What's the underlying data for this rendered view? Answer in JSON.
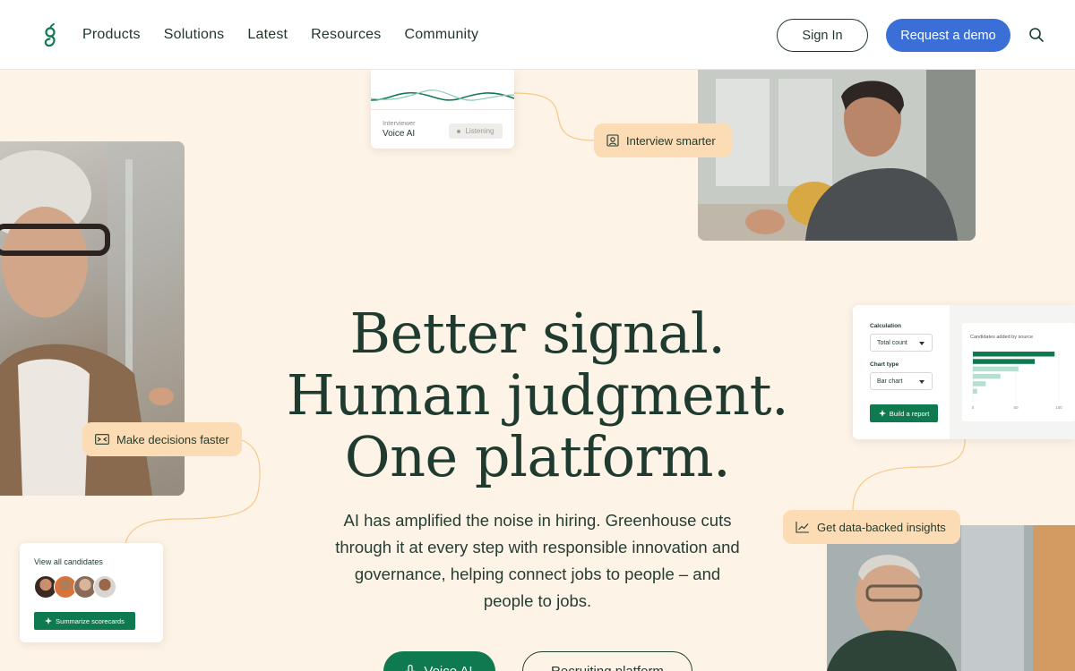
{
  "header": {
    "nav": [
      "Products",
      "Solutions",
      "Latest",
      "Resources",
      "Community"
    ],
    "sign_in": "Sign In",
    "request_demo": "Request a demo"
  },
  "voice_card": {
    "interviewer_label": "Interviewer",
    "interviewer_name": "Voice AI",
    "status": "Listening"
  },
  "pills": {
    "interview": "Interview smarter",
    "decisions": "Make decisions faster",
    "insights": "Get data-backed insights"
  },
  "chart_card": {
    "calculation_label": "Calculation",
    "calculation_value": "Total count",
    "chart_type_label": "Chart type",
    "chart_type_value": "Bar chart",
    "build_button": "Build a report",
    "chart_title": "Candidates added by source",
    "ticks": [
      "0",
      "50",
      "100"
    ],
    "bar_values": [
      95,
      72,
      53,
      32,
      15,
      5
    ],
    "colors": {
      "dark": "#0f7a4f",
      "light": "#b7ded0"
    }
  },
  "candidates_card": {
    "title": "View all candidates",
    "button": "Summarize scorecards"
  },
  "hero": {
    "line1": "Better signal.",
    "line2": "Human judgment.",
    "line3": "One platform.",
    "subtitle": "AI has amplified the noise in hiring. Greenhouse cuts through it at every step with responsible innovation and governance, helping connect jobs to people – and people to jobs.",
    "cta_voice": "Voice AI",
    "cta_recruiting": "Recruiting platform"
  },
  "colors": {
    "background": "#fdf3e7",
    "brand_green": "#0f7a4f",
    "demo_blue": "#3a6fd8",
    "pill": "#fbdcb5",
    "text_dark": "#1f3a2e"
  }
}
